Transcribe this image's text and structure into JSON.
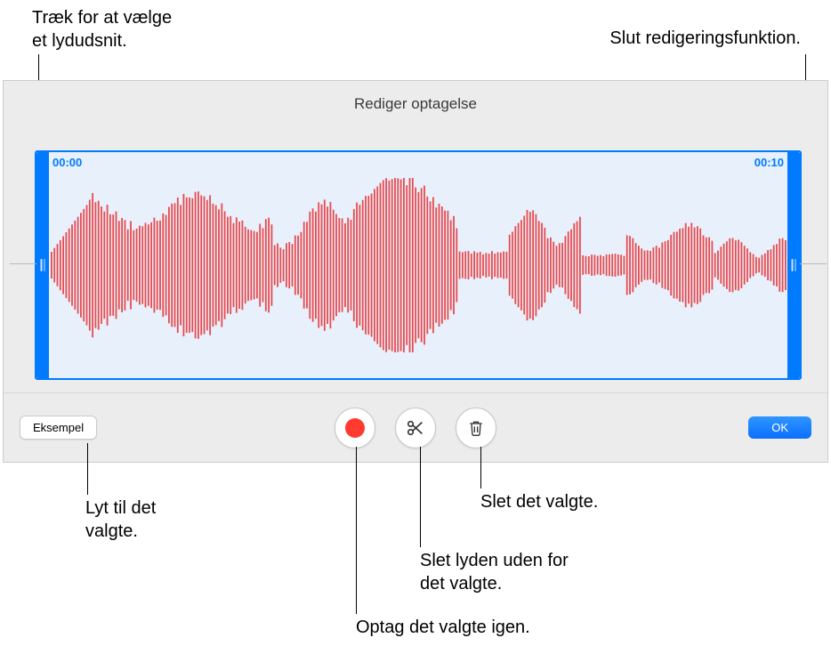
{
  "callouts": {
    "drag_select": "Træk for at vælge\net lydudsnit.",
    "end_editing": "Slut redigeringsfunktion.",
    "listen": "Lyt til det\nvalgte.",
    "delete_selection": "Slet det valgte.",
    "delete_outside": "Slet lyden uden for\ndet valgte.",
    "record_again": "Optag det valgte igen."
  },
  "panel": {
    "title": "Rediger optagelse",
    "time_start": "00:00",
    "time_end": "00:10"
  },
  "toolbar": {
    "preview_label": "Eksempel",
    "ok_label": "OK"
  },
  "icons": {
    "record": "record-icon",
    "scissors": "scissors-icon",
    "trash": "trash-icon"
  },
  "colors": {
    "waveform": "#e84b4f",
    "accent": "#007aff"
  }
}
